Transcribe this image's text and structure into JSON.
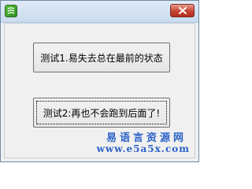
{
  "window": {
    "title": "",
    "icon": "app-icon",
    "close_icon": "close-icon"
  },
  "buttons": {
    "test1_label": "测试1.易失去总在最前的状态",
    "test2_label": "测试2:再也不会跑到后面了!"
  },
  "watermark": {
    "line1": "易语言资源网",
    "line2": "www.e5a5x.com"
  },
  "colors": {
    "close_button": "#c54331",
    "watermark_text": "#2b62c8",
    "client_background": "#f0f0f0"
  }
}
